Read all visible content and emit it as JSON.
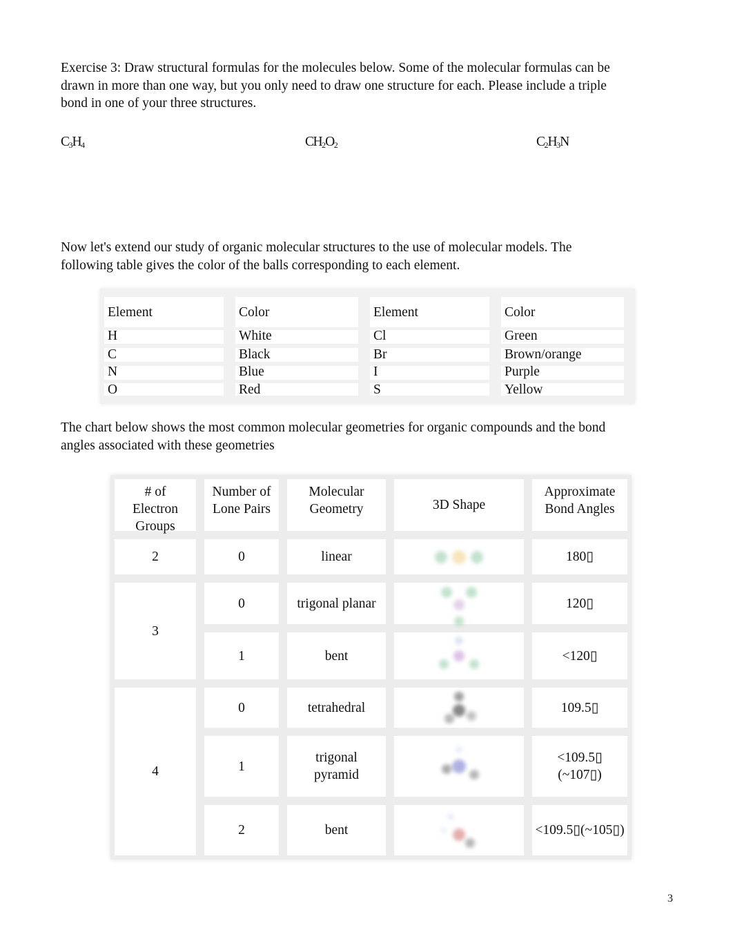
{
  "exercise": {
    "lines": [
      "Exercise 3: Draw structural formulas for the molecules below.   Some of the molecular formulas can be",
      "drawn in more than one way, but you only need to draw one structure for each.      Please include a triple",
      "bond in one of your three structures."
    ],
    "formulas": [
      {
        "parts": [
          {
            "t": "C"
          },
          {
            "sub": "3"
          },
          {
            "t": "H"
          },
          {
            "sub": "4"
          }
        ],
        "label": "C3H4"
      },
      {
        "parts": [
          {
            "t": "CH"
          },
          {
            "sub": "2"
          },
          {
            "t": "O"
          },
          {
            "sub": "2"
          }
        ],
        "label": "CH2O2"
      },
      {
        "parts": [
          {
            "t": "C"
          },
          {
            "sub": "2"
          },
          {
            "t": "H"
          },
          {
            "sub": "3"
          },
          {
            "t": "N"
          }
        ],
        "label": "C2H3N"
      }
    ]
  },
  "models_intro": {
    "lines": [
      "Now let's extend our study of organic molecular structures to the use of molecular models. The",
      "following table gives the color of the balls corresponding to each element."
    ]
  },
  "element_table": {
    "headers": [
      "Element",
      "Color",
      "Element",
      "Color"
    ],
    "rows": [
      [
        "H",
        "White",
        "Cl",
        "Green"
      ],
      [
        "C",
        "Black",
        "Br",
        "Brown/orange"
      ],
      [
        "N",
        "Blue",
        "I",
        "Purple"
      ],
      [
        "O",
        "Red",
        "S",
        "Yellow"
      ]
    ]
  },
  "geometry_intro": {
    "lines": [
      "The chart below shows the most common molecular geometries for organic compounds and the bond",
      "angles associated with these geometries"
    ]
  },
  "geometry_table": {
    "headers": [
      "# of Electron Groups",
      "Number of Lone Pairs",
      "Molecular Geometry",
      "3D Shape",
      "Approximate Bond Angles"
    ],
    "header_lines": [
      [
        "# of",
        "Electron",
        "Groups"
      ],
      [
        "Number of",
        "Lone Pairs"
      ],
      [
        "Molecular",
        "Geometry"
      ],
      [
        "3D Shape"
      ],
      [
        "Approximate",
        "Bond Angles"
      ]
    ],
    "groups": [
      {
        "electron_groups": "2",
        "rows": [
          {
            "lone_pairs": "0",
            "geometry": [
              "linear"
            ],
            "shape_icon": "linear-molecule-icon",
            "angle": [
              "180▯"
            ]
          }
        ]
      },
      {
        "electron_groups": "3",
        "rows": [
          {
            "lone_pairs": "0",
            "geometry": [
              "trigonal planar"
            ],
            "shape_icon": "trigonal-planar-molecule-icon",
            "angle": [
              "120▯"
            ]
          },
          {
            "lone_pairs": "1",
            "geometry": [
              "bent"
            ],
            "shape_icon": "bent-molecule-icon",
            "angle": [
              "<120▯"
            ]
          }
        ]
      },
      {
        "electron_groups": "4",
        "rows": [
          {
            "lone_pairs": "0",
            "geometry": [
              "tetrahedral"
            ],
            "shape_icon": "tetrahedral-molecule-icon",
            "angle": [
              "109.5▯"
            ]
          },
          {
            "lone_pairs": "1",
            "geometry": [
              "trigonal",
              "pyramid"
            ],
            "shape_icon": "trigonal-pyramid-molecule-icon",
            "angle": [
              "<109.5▯",
              "(~107▯)"
            ]
          },
          {
            "lone_pairs": "2",
            "geometry": [
              "bent"
            ],
            "shape_icon": "bent-tetrahedral-molecule-icon",
            "angle": [
              "<109.5▯(~105▯)"
            ]
          }
        ]
      }
    ]
  },
  "page_number": "3"
}
